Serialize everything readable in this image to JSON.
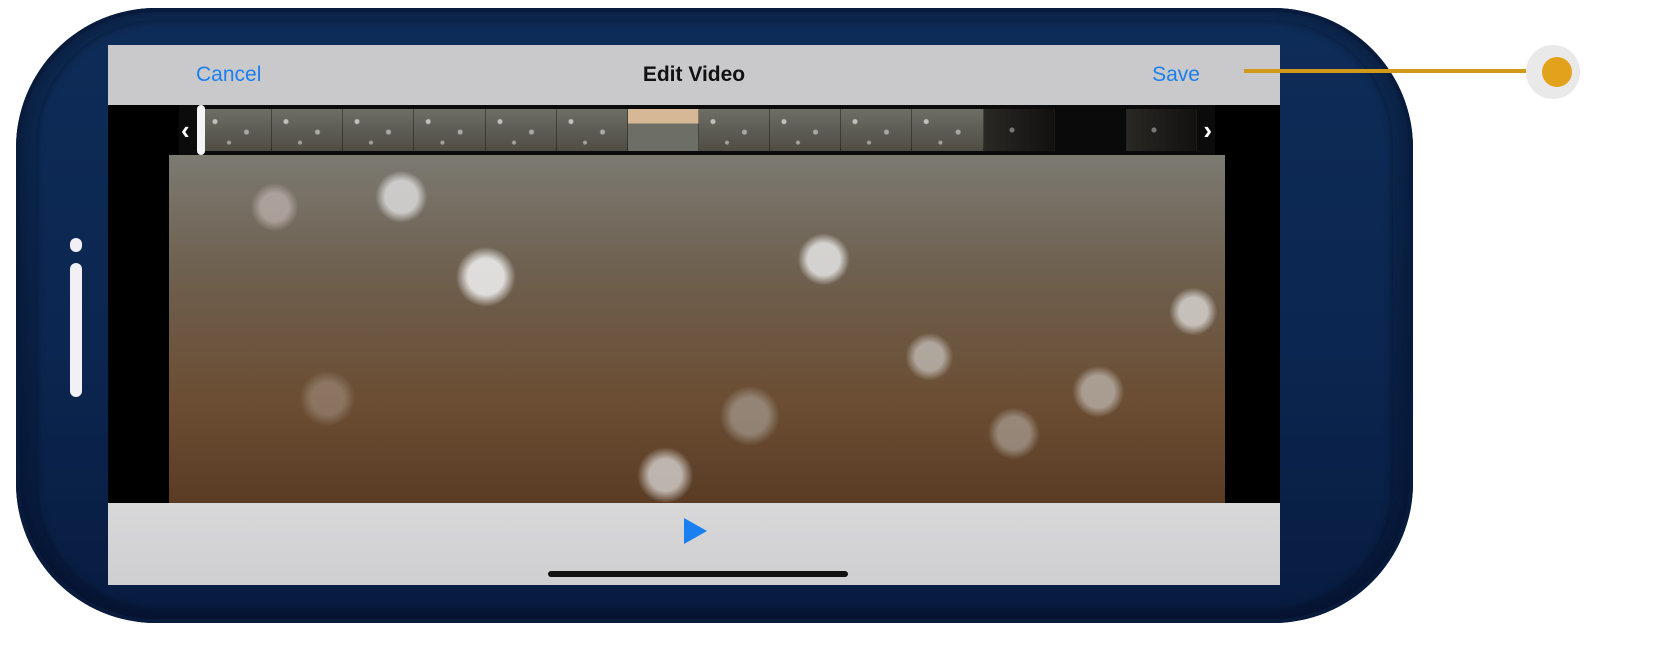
{
  "header": {
    "cancel_label": "Cancel",
    "title": "Edit Video",
    "save_label": "Save"
  },
  "trim_strip": {
    "left_handle": "‹",
    "right_handle": "›"
  },
  "controls": {
    "play_icon": "play-icon"
  },
  "colors": {
    "accent": "#1a7ff0",
    "callout": "#e3a21c",
    "device_frame": "#0b2650"
  }
}
